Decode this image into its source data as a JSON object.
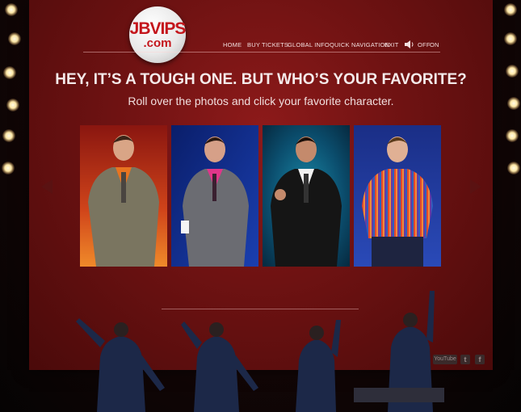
{
  "logo": {
    "line1": "JBVIPS",
    "line2": ".com"
  },
  "nav": {
    "home": "HOME",
    "buy_tickets": "BUY TICKETS",
    "global_info": "GLOBAL INFO",
    "quick_navigation": "QUICK NAVIGATION",
    "exit": "EXIT",
    "sound_off": "OFF",
    "sound_on": "ON"
  },
  "headline": "HEY, IT’S A TOUGH ONE. BUT WHO’S YOUR FAVORITE?",
  "subheadline": "Roll over the photos and click your favorite character.",
  "characters": [
    {
      "icon": "character-photo-grey-suit-orange-shirt"
    },
    {
      "icon": "character-photo-grey-suit-pink-shirt"
    },
    {
      "icon": "character-photo-black-suit-white-shirt"
    },
    {
      "icon": "character-photo-striped-shirt"
    }
  ],
  "social": {
    "youtube": "YouTube",
    "twitter": "t",
    "facebook": "f"
  },
  "colors": {
    "panel": "#7a1414",
    "logo_red": "#c4161c",
    "nav_text": "#f2dede"
  }
}
